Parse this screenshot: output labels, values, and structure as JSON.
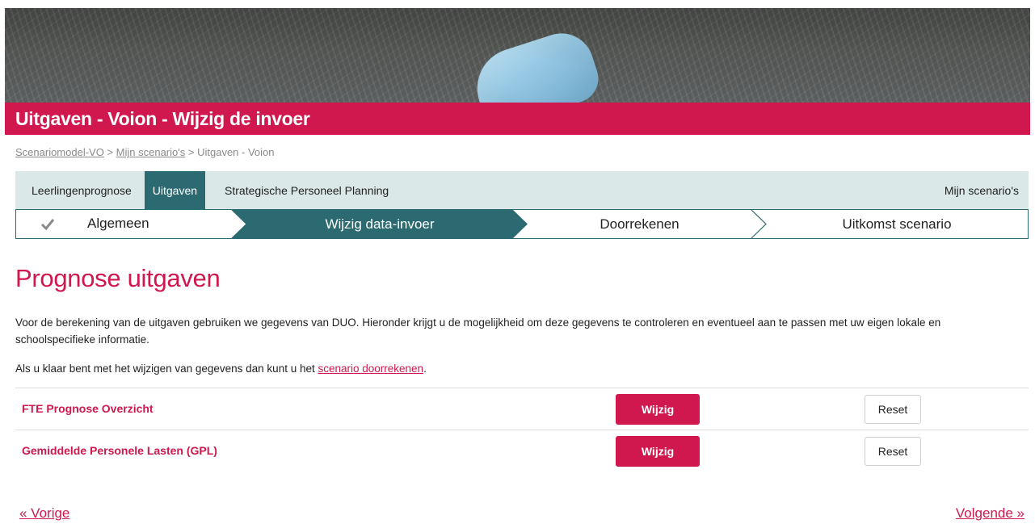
{
  "header": {
    "title": "Uitgaven - Voion - Wijzig de invoer"
  },
  "breadcrumb": {
    "items": [
      "Scenariomodel-VO",
      "Mijn scenario's",
      "Uitgaven - Voion"
    ],
    "separator": ">"
  },
  "tabs": {
    "items": [
      {
        "label": "Leerlingenprognose",
        "active": false
      },
      {
        "label": "Uitgaven",
        "active": true
      },
      {
        "label": "Strategische Personeel Planning",
        "active": false
      }
    ],
    "right_label": "Mijn scenario's"
  },
  "steps": {
    "items": [
      {
        "label": "Algemeen",
        "state": "done",
        "icon": "check-icon"
      },
      {
        "label": "Wijzig data-invoer",
        "state": "active"
      },
      {
        "label": "Doorrekenen",
        "state": "todo"
      },
      {
        "label": "Uitkomst scenario",
        "state": "todo"
      }
    ]
  },
  "main": {
    "title": "Prognose uitgaven",
    "intro": "Voor de berekening van de uitgaven gebruiken we gegevens van DUO. Hieronder krijgt u de mogelijkheid om deze gegevens te controleren en eventueel aan te passen met uw eigen lokale en schoolspecifieke informatie.",
    "done_prefix": "Als u klaar bent met het wijzigen van gegevens dan kunt u het ",
    "done_link": "scenario doorrekenen",
    "done_suffix": ".",
    "rows": [
      {
        "label": "FTE Prognose Overzicht",
        "edit_label": "Wijzig",
        "reset_label": "Reset"
      },
      {
        "label": "Gemiddelde Personele Lasten (GPL)",
        "edit_label": "Wijzig",
        "reset_label": "Reset"
      }
    ]
  },
  "pager": {
    "prev_label": "« Vorige",
    "next_label": "Volgende »"
  },
  "colors": {
    "brand": "#d0174e",
    "teal": "#2b6a70",
    "tab_bg": "#dbe8e8"
  }
}
